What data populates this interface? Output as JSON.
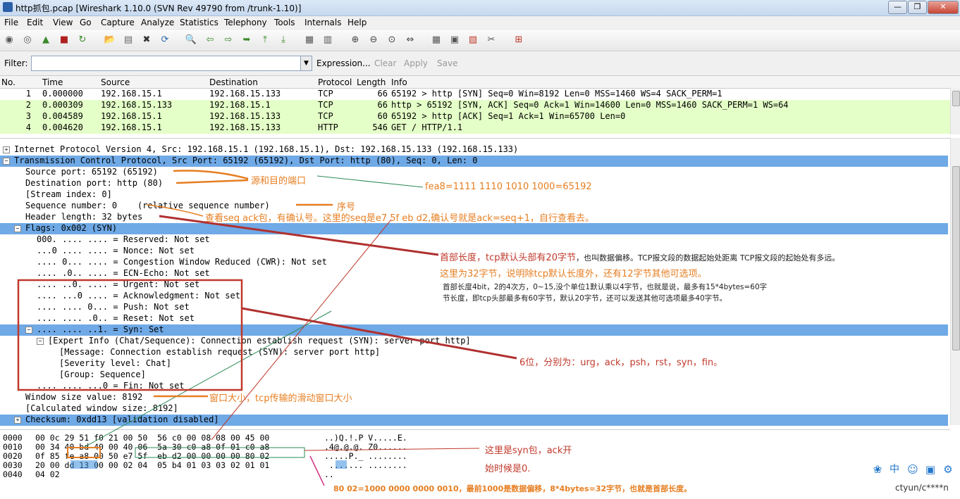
{
  "window": {
    "title": "http抓包.pcap   [Wireshark 1.10.0  (SVN Rev 49790 from /trunk-1.10)]",
    "min": "—",
    "max": "❐",
    "close": "✕"
  },
  "menu": [
    "File",
    "Edit",
    "View",
    "Go",
    "Capture",
    "Analyze",
    "Statistics",
    "Telephony",
    "Tools",
    "Internals",
    "Help"
  ],
  "toolbar_icons": [
    "interface-list-icon",
    "capture-options-icon",
    "start-capture-icon",
    "stop-capture-icon",
    "restart-capture-icon",
    "open-file-icon",
    "save-file-icon",
    "close-file-icon",
    "reload-icon",
    "find-icon",
    "back-icon",
    "forward-icon",
    "go-to-packet-icon",
    "first-packet-icon",
    "last-packet-icon",
    "colorize-icon",
    "auto-scroll-icon",
    "zoom-in-icon",
    "zoom-out-icon",
    "normal-size-icon",
    "resize-columns-icon",
    "capture-filters-icon",
    "display-filters-icon",
    "coloring-rules-icon",
    "preferences-icon",
    "help-icon"
  ],
  "filter": {
    "label": "Filter:",
    "value": "",
    "expression": "Expression...",
    "clear": "Clear",
    "apply": "Apply",
    "save": "Save"
  },
  "packet_list": {
    "columns": [
      "No.",
      "Time",
      "Source",
      "Destination",
      "Protocol",
      "Length",
      "Info"
    ],
    "rows": [
      {
        "no": "1",
        "time": "0.000000",
        "src": "192.168.15.1",
        "dst": "192.168.15.133",
        "proto": "TCP",
        "len": "66",
        "info": "65192 > http [SYN] Seq=0 Win=8192 Len=0 MSS=1460 WS=4 SACK_PERM=1",
        "color": "#ffffff"
      },
      {
        "no": "2",
        "time": "0.000309",
        "src": "192.168.15.133",
        "dst": "192.168.15.1",
        "proto": "TCP",
        "len": "66",
        "info": "http > 65192 [SYN, ACK] Seq=0 Ack=1 Win=14600 Len=0 MSS=1460 SACK_PERM=1 WS=64",
        "color": "#e4ffc7"
      },
      {
        "no": "3",
        "time": "0.004589",
        "src": "192.168.15.1",
        "dst": "192.168.15.133",
        "proto": "TCP",
        "len": "60",
        "info": "65192 > http [ACK] Seq=1 Ack=1 Win=65700 Len=0",
        "color": "#e4ffc7"
      },
      {
        "no": "4",
        "time": "0.004620",
        "src": "192.168.15.1",
        "dst": "192.168.15.133",
        "proto": "HTTP",
        "len": "546",
        "info": "GET / HTTP/1.1",
        "color": "#e4ffc7"
      }
    ]
  },
  "detail": [
    {
      "text": "Internet Protocol Version 4, Src: 192.168.15.1 (192.168.15.1), Dst: 192.168.15.133 (192.168.15.133)",
      "indent": 0,
      "toggle": "⊞",
      "sel": false
    },
    {
      "text": "Transmission Control Protocol, Src Port: 65192 (65192), Dst Port: http (80), Seq: 0, Len: 0",
      "indent": 0,
      "toggle": "⊟",
      "sel": true
    },
    {
      "text": "Source port: 65192 (65192)",
      "indent": 1,
      "toggle": "",
      "sel": false
    },
    {
      "text": "Destination port: http (80)",
      "indent": 1,
      "toggle": "",
      "sel": false
    },
    {
      "text": "[Stream index: 0]",
      "indent": 1,
      "toggle": "",
      "sel": false
    },
    {
      "text": "Sequence number: 0    (relative sequence number)",
      "indent": 1,
      "toggle": "",
      "sel": false
    },
    {
      "text": "Header length: 32 bytes",
      "indent": 1,
      "toggle": "",
      "sel": false
    },
    {
      "text": "Flags: 0x002 (SYN)",
      "indent": 1,
      "toggle": "⊟",
      "sel": true
    },
    {
      "text": "000. .... .... = Reserved: Not set",
      "indent": 2,
      "toggle": "",
      "sel": false
    },
    {
      "text": "...0 .... .... = Nonce: Not set",
      "indent": 2,
      "toggle": "",
      "sel": false
    },
    {
      "text": ".... 0... .... = Congestion Window Reduced (CWR): Not set",
      "indent": 2,
      "toggle": "",
      "sel": false
    },
    {
      "text": ".... .0.. .... = ECN-Echo: Not set",
      "indent": 2,
      "toggle": "",
      "sel": false
    },
    {
      "text": ".... ..0. .... = Urgent: Not set",
      "indent": 2,
      "toggle": "",
      "sel": false
    },
    {
      "text": ".... ...0 .... = Acknowledgment: Not set",
      "indent": 2,
      "toggle": "",
      "sel": false
    },
    {
      "text": ".... .... 0... = Push: Not set",
      "indent": 2,
      "toggle": "",
      "sel": false
    },
    {
      "text": ".... .... .0.. = Reset: Not set",
      "indent": 2,
      "toggle": "",
      "sel": false
    },
    {
      "text": ".... .... ..1. = Syn: Set",
      "indent": 2,
      "toggle": "⊟",
      "sel": true
    },
    {
      "text": "[Expert Info (Chat/Sequence): Connection establish request (SYN): server port http]",
      "indent": 3,
      "toggle": "⊟",
      "sel": false
    },
    {
      "text": "[Message: Connection establish request (SYN): server port http]",
      "indent": 4,
      "toggle": "",
      "sel": false
    },
    {
      "text": "[Severity level: Chat]",
      "indent": 4,
      "toggle": "",
      "sel": false
    },
    {
      "text": "[Group: Sequence]",
      "indent": 4,
      "toggle": "",
      "sel": false
    },
    {
      "text": ".... .... ...0 = Fin: Not set",
      "indent": 2,
      "toggle": "",
      "sel": false
    },
    {
      "text": "Window size value: 8192",
      "indent": 1,
      "toggle": "",
      "sel": false
    },
    {
      "text": "[Calculated window size: 8192]",
      "indent": 1,
      "toggle": "",
      "sel": false
    },
    {
      "text": "Checksum: 0xdd13 [validation disabled]",
      "indent": 1,
      "toggle": "⊞",
      "sel": true
    }
  ],
  "bytes": [
    {
      "offset": "0000",
      "hex": "00 0c 29 51 f0 21 00 50  56 c0 00 08 08 00 45 00",
      "ascii": "..)Q.!.P V.....E."
    },
    {
      "offset": "0010",
      "hex": "00 34 40 bd 40 00 40 06  5a 30 c0 a8 0f 01 c0 a8",
      "ascii": ".4@.@.@. Z0......"
    },
    {
      "offset": "0020",
      "hex": "0f 85 fe a8 00 50 e7 5f  eb d2 00 00 00 00 80 02",
      "ascii": ".....P._ ........"
    },
    {
      "offset": "0030",
      "hex": "20 00 dd 13 00 00 02 04  05 b4 01 03 03 02 01 01",
      "ascii": " ....... ........"
    },
    {
      "offset": "0040",
      "hex": "04 02",
      "ascii": ".."
    }
  ],
  "annotations": {
    "ports": "源和目的端口",
    "fea8": "fea8=1111 1110 1010 1000=65192",
    "seq": "序号",
    "seqack": "查看seq ack包，有确认号。这里的seq是e7 5f eb d2,确认号就是ack=seq+1，自行查看去。",
    "hdr1": "首部长度，tcp默认头部有20字节",
    "hdr1b": "，也叫数据偏移。TCP报文段的数据起始处距离 TCP报文段的起始处有多远。",
    "hdr2": "这里为32字节，说明除tcp默认长度外，还有12字节其他可选项。",
    "hdr3": "首部长度4bit，2的4次方，0~15,没个单位1默认乘以4字节，也就是说，最多有15*4bytes=60字",
    "hdr4": "节长度，即tcp头部最多有60字节，默认20字节，还可以发送其他可选项最多40字节。",
    "flags6": "6位，分别为：urg，ack，psh，rst，syn，fin。",
    "window": "窗口大小，tcp传输的滑动窗口大小",
    "syn1": "这里是syn包，ack开",
    "syn2": "始时候是0.",
    "offset": "80 02=1000 0000 0000 0010，最前1000是数据偏移，8*4bytes=32字节，也就是首部长度。"
  },
  "status_icons": [
    "paw-icon",
    "chinese-input-icon",
    "smiley-icon",
    "image-icon",
    "settings-icon"
  ],
  "watermark": "ctyun/c****n"
}
